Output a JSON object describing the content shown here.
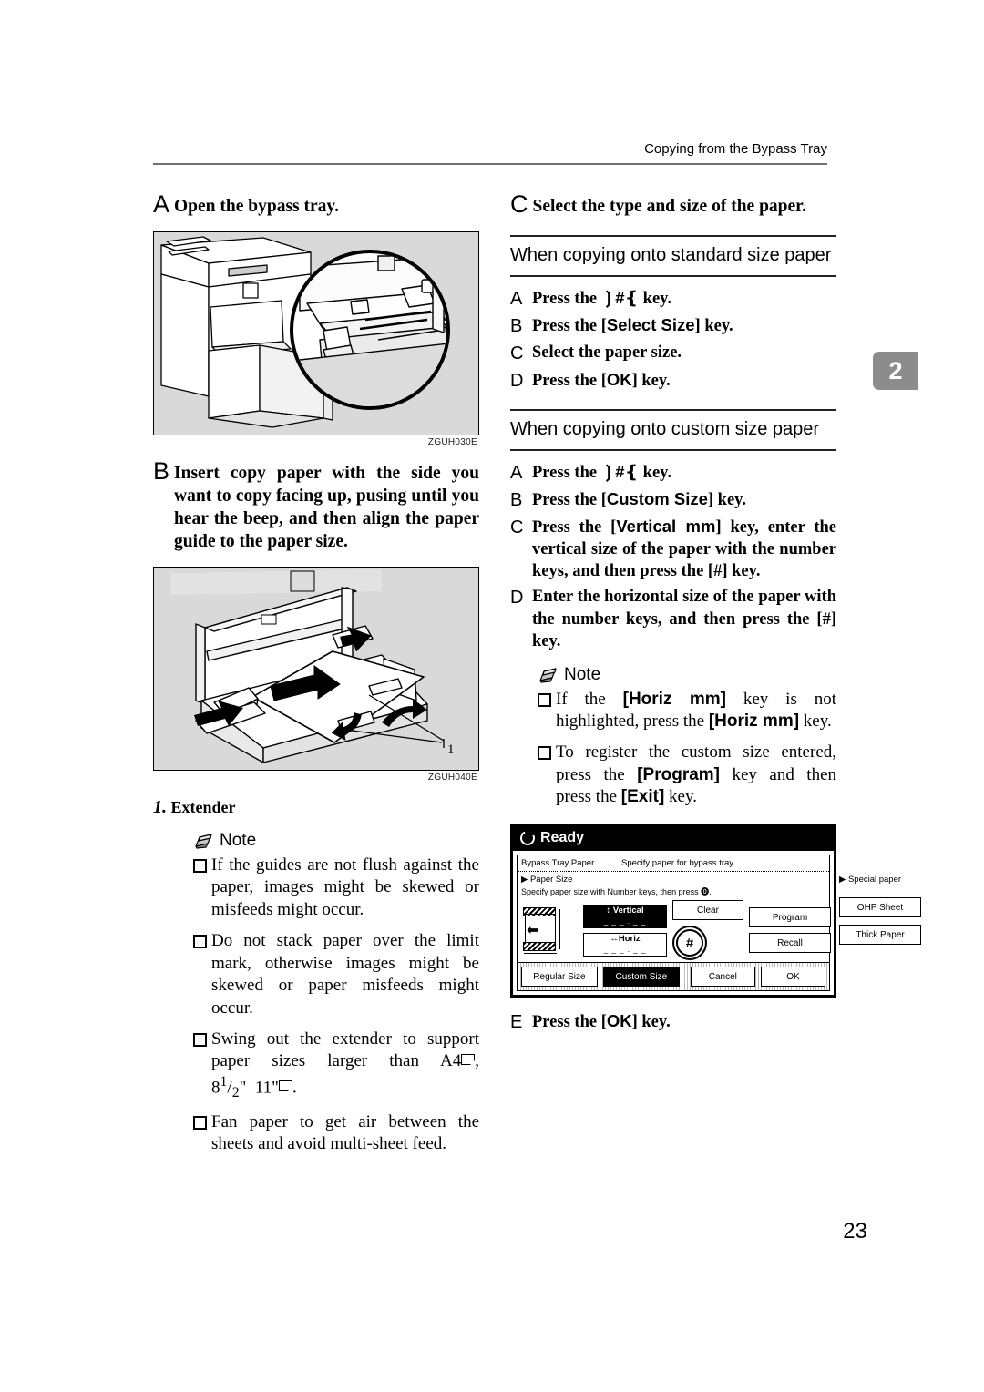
{
  "header": {
    "running_title": "Copying from the Bypass Tray"
  },
  "chapter_tab": {
    "number": "2"
  },
  "page": {
    "number": "23"
  },
  "left_column": {
    "step_a": {
      "marker": "A",
      "text": "Open the bypass tray."
    },
    "figure_1": {
      "code": "ZGUH030E",
      "alt": "Copier with bypass tray opened, magnified circular inset"
    },
    "step_b": {
      "marker": "B",
      "text": "Insert copy paper with the side you want to copy facing up, pusing until you hear the beep, and then align the paper guide to the paper size."
    },
    "figure_2": {
      "code": "ZGUH040E",
      "callout_number": "1",
      "alt": "Paper being inserted into bypass tray with guides"
    },
    "callout": {
      "number": "1.",
      "label": "Extender"
    },
    "note_label": "Note",
    "notes": [
      "If the guides are not flush against the paper, images might be skewed or misfeeds might occur.",
      "Do not stack paper over the limit mark, otherwise images might be skewed or paper misfeeds might occur.",
      "Swing out the extender to support paper sizes larger than A4⬒, 8¹/₂\" × 11\"⬒.",
      "Fan paper to get air between the sheets and avoid multi-sheet feed."
    ],
    "note_3_parts": {
      "lead": "Swing out the extender to support paper sizes larger than ",
      "size_a": "A4",
      "sep": ", 8",
      "frac_num": "1",
      "frac_den": "2",
      "inch": "\"",
      "size_b": "11\"",
      "tail": "."
    }
  },
  "right_column": {
    "step_c": {
      "marker": "C",
      "text": "Select the type and size of the paper."
    },
    "section_standard": {
      "title": "When copying onto standard size paper",
      "steps": [
        {
          "letter": "A",
          "pre": "Press the ",
          "key": "#",
          "key_style": "hash",
          "post": " key."
        },
        {
          "letter": "B",
          "pre": "Press the [",
          "key": "Select Size",
          "key_style": "bracket",
          "post": "] key."
        },
        {
          "letter": "C",
          "pre": "Select the paper size.",
          "key": "",
          "key_style": "none",
          "post": ""
        },
        {
          "letter": "D",
          "pre": "Press the [",
          "key": "OK",
          "key_style": "bracket",
          "post": "] key."
        }
      ]
    },
    "section_custom": {
      "title": "When copying onto custom size paper",
      "steps": [
        {
          "letter": "A",
          "pre": "Press the ",
          "key": "#",
          "key_style": "hash",
          "post": " key."
        },
        {
          "letter": "B",
          "pre": "Press the [",
          "key": "Custom Size",
          "key_style": "bracket",
          "post": "] key."
        },
        {
          "letter": "C",
          "pre": "Press the [",
          "key": "Vertical mm",
          "key_style": "bracket",
          "post": "] key, enter the vertical size of the paper with the number keys, and then press the [#] key."
        },
        {
          "letter": "D",
          "pre": "Enter the horizontal size of the paper with the number keys, and then press the [#] key.",
          "key": "",
          "key_style": "none",
          "post": ""
        }
      ]
    },
    "note_label": "Note",
    "notes": [
      {
        "segments": [
          {
            "t": "If the ",
            "b": false
          },
          {
            "t": "[Horiz mm]",
            "b": true
          },
          {
            "t": " key is not highlighted, press the ",
            "b": false
          },
          {
            "t": "[Horiz mm]",
            "b": true
          },
          {
            "t": " key.",
            "b": false
          }
        ]
      },
      {
        "segments": [
          {
            "t": "To register the custom size entered, press the ",
            "b": false
          },
          {
            "t": "[Program]",
            "b": true
          },
          {
            "t": " key and then press the ",
            "b": false
          },
          {
            "t": "[Exit]",
            "b": true
          },
          {
            "t": " key.",
            "b": false
          }
        ]
      }
    ],
    "step_e": {
      "letter": "E",
      "pre": "Press the [",
      "key": "OK",
      "post": "] key."
    }
  },
  "lcd_panel": {
    "status": "Ready",
    "title_bar_left": "Bypass Tray Paper",
    "title_bar_right": "Specify paper for bypass tray.",
    "section_label": "▶ Paper Size",
    "section_hint": "Specify paper size with Number keys, then press ⓿.",
    "special_label": "▶ Special paper",
    "vertical_key": {
      "label": "↕ Vertical",
      "value": "_ _ _ . _ _",
      "selected": true
    },
    "horiz_key": {
      "label": "↔Horiz",
      "value": "_ _ _ . _ _",
      "selected": false
    },
    "hash_button": "#",
    "buttons_mid": [
      "Clear",
      "Program",
      "Recall"
    ],
    "buttons_special": [
      "OHP Sheet",
      "Thick Paper"
    ],
    "tabs": [
      {
        "label": "Regular Size",
        "selected": false
      },
      {
        "label": "Custom Size",
        "selected": true
      }
    ],
    "footer_buttons": [
      {
        "label": "Cancel",
        "selected": false
      },
      {
        "label": "OK",
        "selected": false
      }
    ]
  }
}
